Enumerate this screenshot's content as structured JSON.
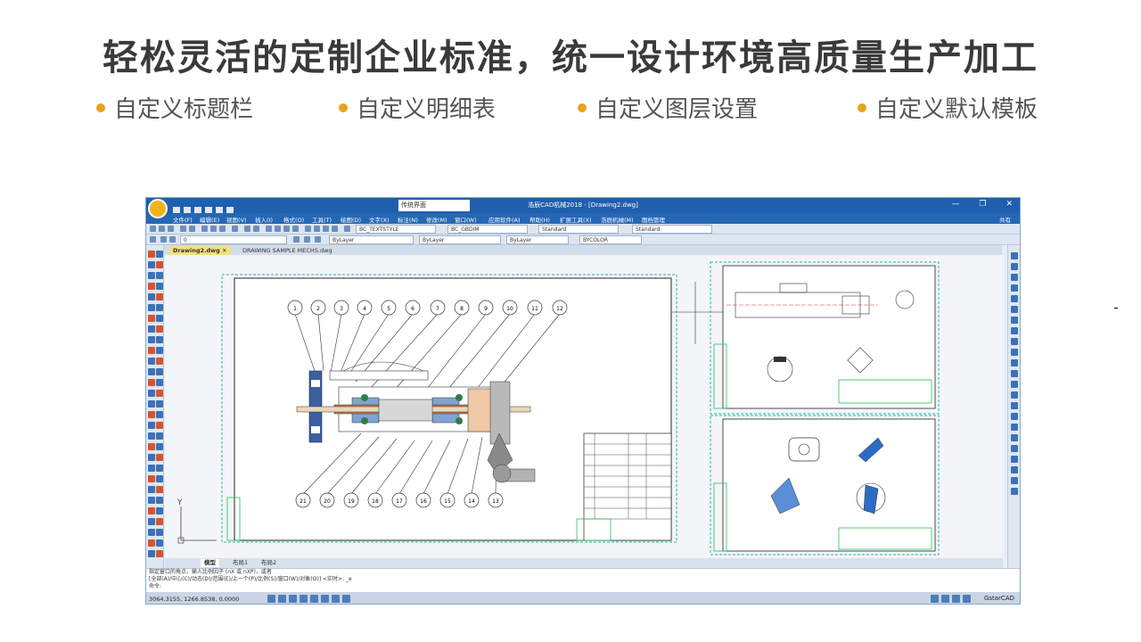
{
  "headline": "轻松灵活的定制企业标准，统一设计环境高质量生产加工",
  "features": [
    {
      "label": "自定义标题栏"
    },
    {
      "label": "自定义明细表"
    },
    {
      "label": "自定义图层设置"
    },
    {
      "label": "自定义默认模板"
    }
  ],
  "colors": {
    "bullet": "#e8a21c",
    "titlebar": "#1f5fae",
    "menubar": "#2667b4"
  },
  "cad": {
    "workspace": "传统界面",
    "window_title": "浩辰CAD机械2018 - [Drawing2.dwg]",
    "window_buttons": [
      "—",
      "❐",
      "✕"
    ],
    "menu": [
      "文件(F)",
      "编辑(E)",
      "视图(V)",
      "插入(I)",
      "格式(O)",
      "工具(T)",
      "绘图(D)",
      "文字(X)",
      "标注(N)",
      "修改(M)",
      "窗口(W)",
      "应用软件(A)",
      "帮助(H)",
      "扩展工具(X)",
      "浩辰机械(M)",
      "图档管理"
    ],
    "menu_help": "共有",
    "toolbar": {
      "text_style": "BC_TEXTSTYLE",
      "dim_style": "BC_GBDIM",
      "table_style": "Standard",
      "multileader_style": "Standard",
      "layer": "0",
      "color": "ByLayer",
      "linetype": "ByLayer",
      "lineweight": "ByLayer",
      "plot_style": "BYCOLOR"
    },
    "tabs": [
      {
        "label": "Drawing2.dwg",
        "close": "✕"
      },
      {
        "label": "DRAWING SAMPLE MECHS.dwg"
      }
    ],
    "layout_tabs": [
      "模型",
      "布局1",
      "布局2"
    ],
    "balloons_top": [
      "1",
      "2",
      "3",
      "4",
      "5",
      "6",
      "7",
      "8",
      "9",
      "10",
      "11",
      "12"
    ],
    "balloons_bottom": [
      "21",
      "20",
      "19",
      "18",
      "17",
      "16",
      "15",
      "14",
      "13"
    ],
    "command_lines": [
      "指定窗口的角点，输入比例因子 (nX 或 nXP)，或者",
      "[全部(A)/中心(C)/动态(D)/范围(E)/上一个(P)/比例(S)/窗口(W)/对象(O)] <实时>: _e",
      "命令:"
    ],
    "coords": "3064.3155, 1266.8538, 0.0000",
    "brand": "GstarCAD",
    "axis_y": "Y"
  }
}
